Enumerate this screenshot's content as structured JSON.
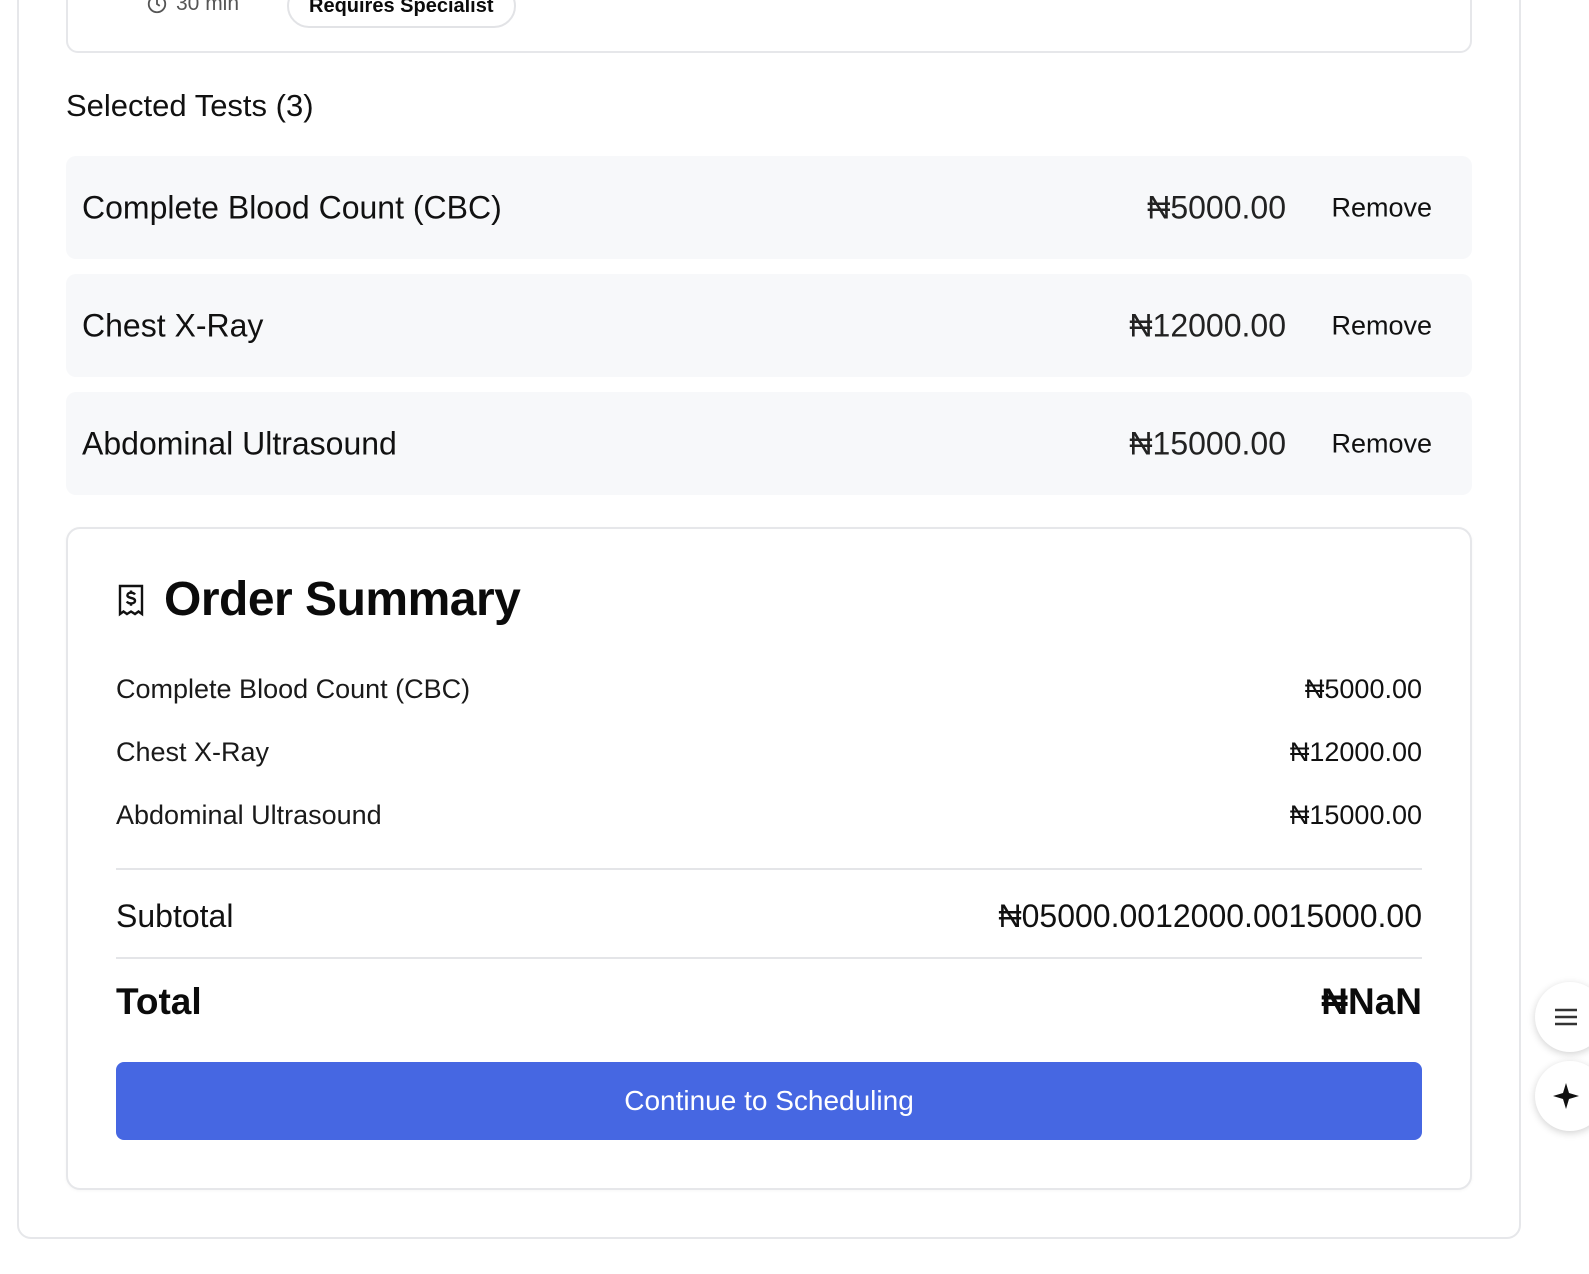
{
  "test_card": {
    "duration": "30 min",
    "badge": "Requires Specialist"
  },
  "selected": {
    "heading": "Selected Tests (3)",
    "items": [
      {
        "name": "Complete Blood Count (CBC)",
        "price": "₦5000.00",
        "remove_label": "Remove"
      },
      {
        "name": "Chest X-Ray",
        "price": "₦12000.00",
        "remove_label": "Remove"
      },
      {
        "name": "Abdominal Ultrasound",
        "price": "₦15000.00",
        "remove_label": "Remove"
      }
    ]
  },
  "summary": {
    "icon": "receipt-icon",
    "title": "Order Summary",
    "lines": [
      {
        "name": "Complete Blood Count (CBC)",
        "amount": "₦5000.00"
      },
      {
        "name": "Chest X-Ray",
        "amount": "₦12000.00"
      },
      {
        "name": "Abdominal Ultrasound",
        "amount": "₦15000.00"
      }
    ],
    "subtotal_label": "Subtotal",
    "subtotal_value": "₦05000.0012000.0015000.00",
    "total_label": "Total",
    "total_value": "₦NaN",
    "continue_label": "Continue to Scheduling"
  },
  "colors": {
    "primary_button": "#4667e2",
    "row_background": "#f7f8fa",
    "border": "#e6e7ea"
  },
  "floating_buttons": [
    "chat-icon",
    "sparkle-icon"
  ]
}
